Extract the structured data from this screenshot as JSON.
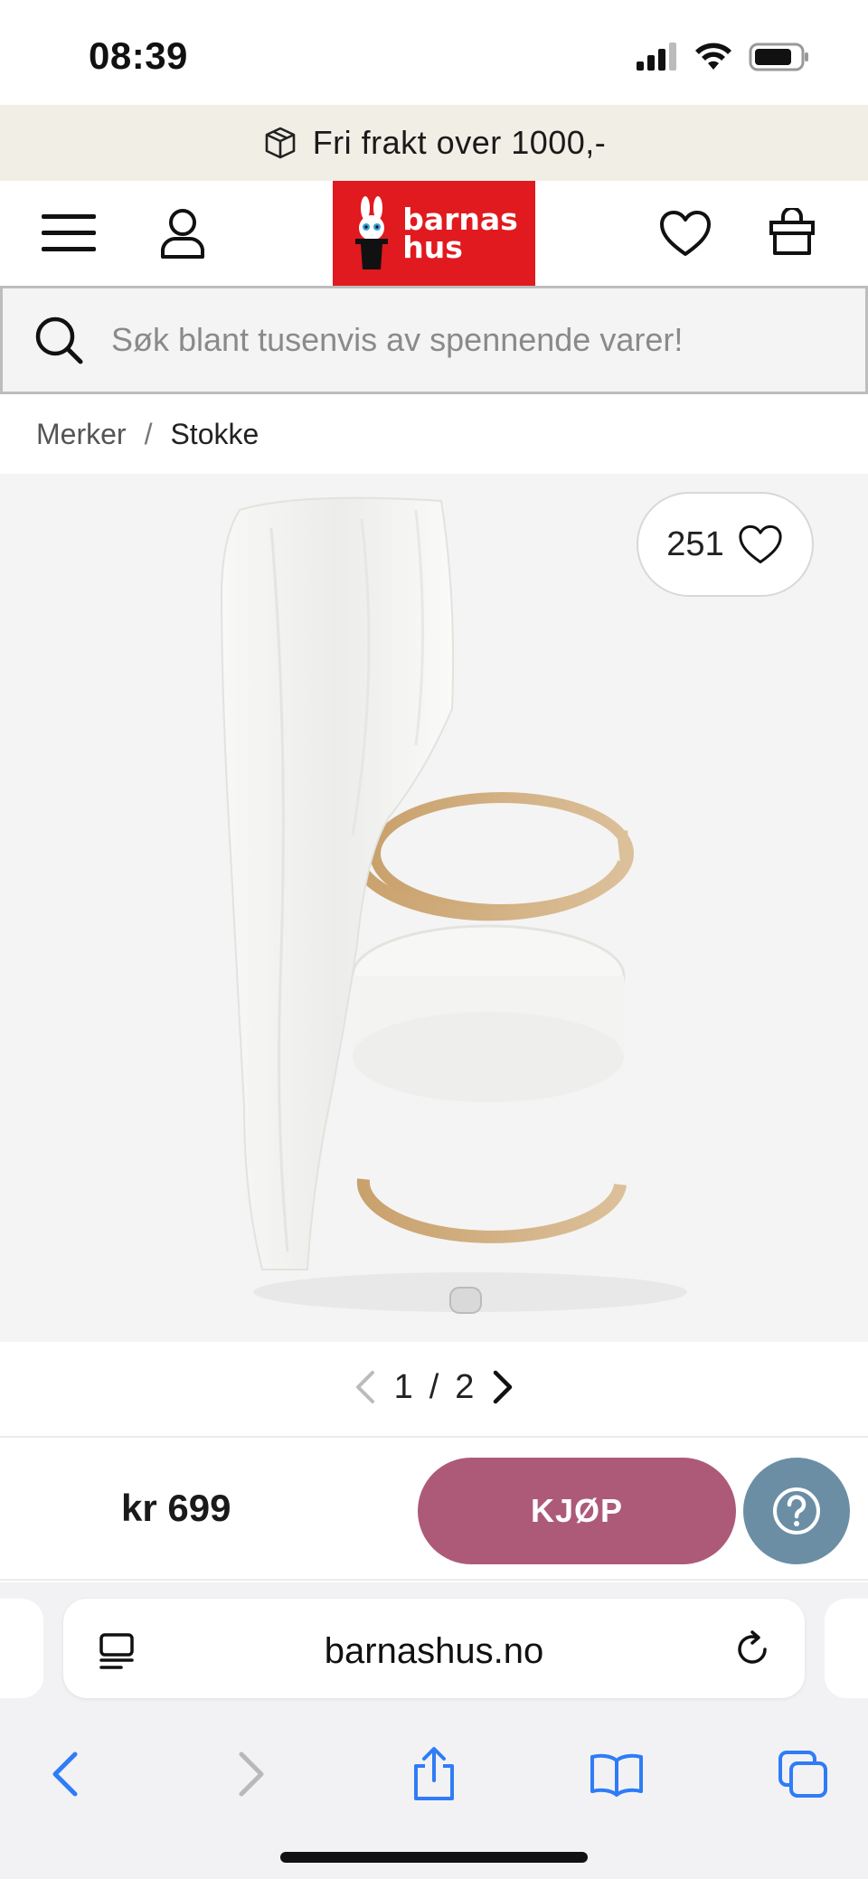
{
  "status": {
    "time": "08:39"
  },
  "promo": {
    "text": "Fri frakt over 1000,-",
    "icon": "package-icon"
  },
  "header": {
    "menu_icon": "hamburger-icon",
    "account_icon": "user-icon",
    "logo_text_line1": "barnas",
    "logo_text_line2": "hus",
    "wishlist_icon": "heart-icon",
    "cart_icon": "shopping-bag-icon",
    "brand_color": "#e01a1f"
  },
  "search": {
    "placeholder": "Søk blant tusenvis av spennende varer!",
    "icon": "search-icon"
  },
  "breadcrumb": {
    "items": [
      "Merker",
      "Stokke"
    ],
    "separator": "/"
  },
  "product": {
    "favorites_count": "251",
    "image_pager": {
      "current": "1",
      "separator": "/",
      "total": "2"
    },
    "price": "kr 699",
    "buy_label": "KJØP",
    "buy_color": "#ad5a79",
    "help_color": "#6b8ea5"
  },
  "browser": {
    "url": "barnashus.no"
  }
}
